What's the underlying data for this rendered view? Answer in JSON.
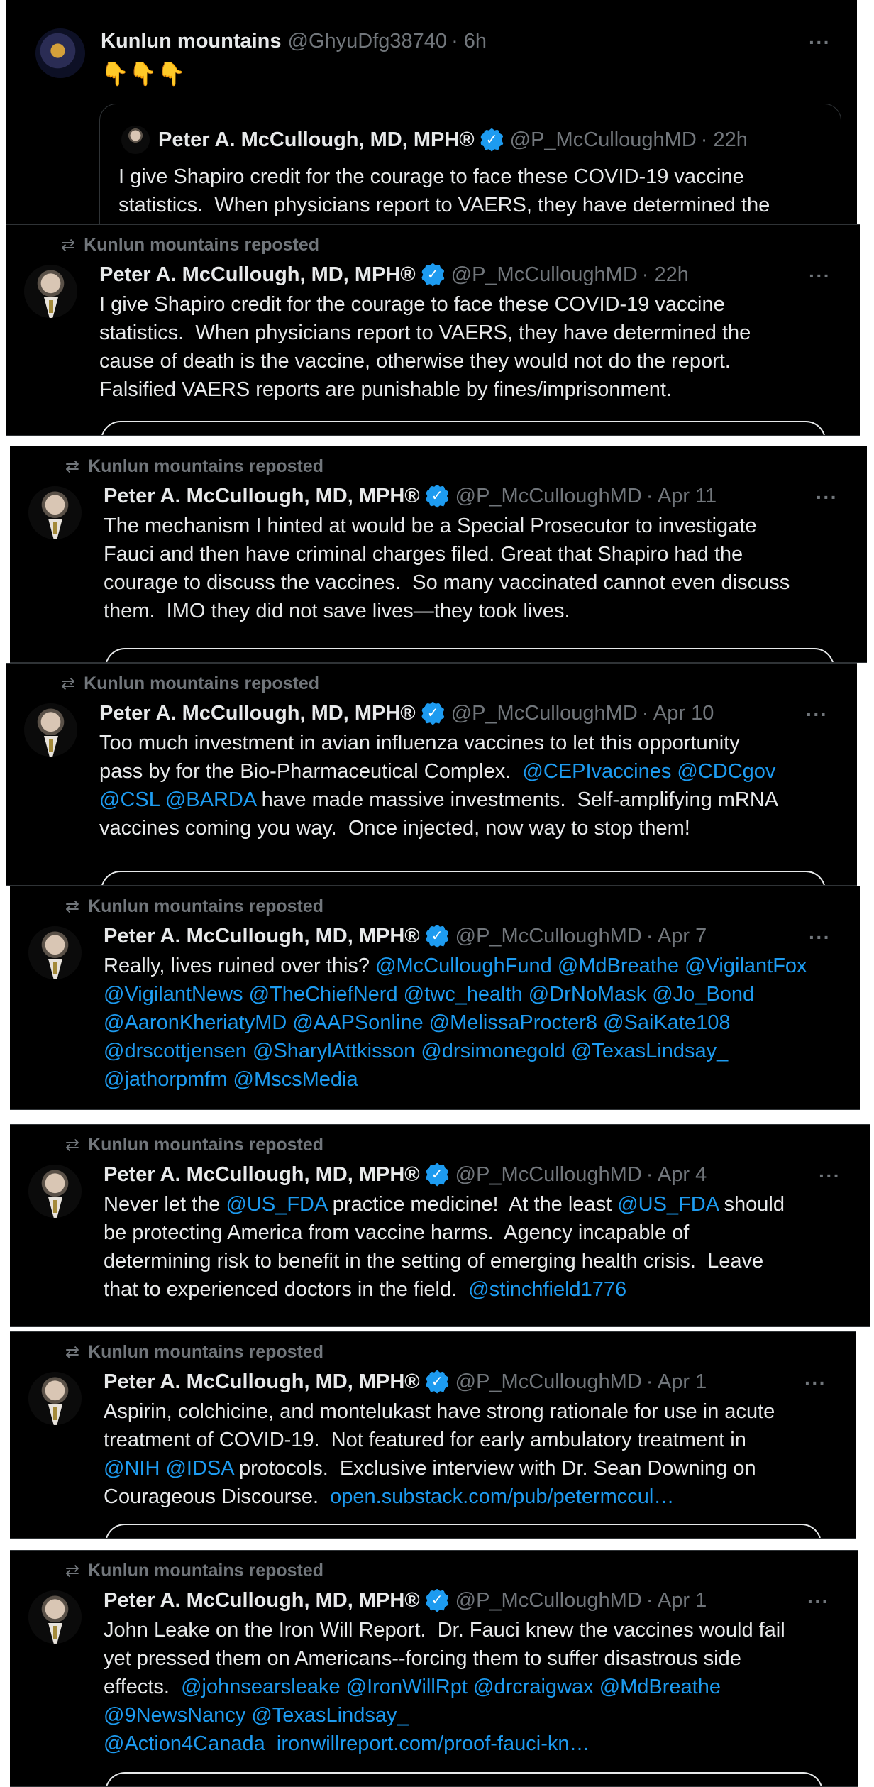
{
  "colors": {
    "background": "#000000",
    "text": "#e7e9ea",
    "secondary": "#71767b",
    "link": "#1d9bf0",
    "border": "#2f3336"
  },
  "icons": {
    "more": "more-horizontal-icon",
    "repost": "repost-icon",
    "verified": "verified-badge-icon"
  },
  "top_post": {
    "name": "Kunlun mountains",
    "handle": "@GhyuDfg38740",
    "time": "· 6h",
    "more": "···",
    "text": "👇👇👇",
    "quote": {
      "name": "Peter A. McCullough, MD, MPH®",
      "handle": "@P_McCulloughMD",
      "time": "· 22h",
      "text": "I give Shapiro credit for the courage to face these COVID-19 vaccine statistics.  When physicians report to VAERS, they have determined the"
    }
  },
  "reposts": [
    {
      "repost_label": "Kunlun mountains reposted",
      "name": "Peter A. McCullough, MD, MPH®",
      "handle": "@P_McCulloughMD",
      "time": "· 22h",
      "more": "···",
      "lines": [
        [
          {
            "t": "I give Shapiro credit for the courage to face these COVID-19 vaccine"
          }
        ],
        [
          {
            "t": "statistics.  When physicians report to VAERS, they have determined the"
          }
        ],
        [
          {
            "t": "cause of death is the vaccine, otherwise they would not do the report."
          }
        ],
        [
          {
            "t": "Falsified VAERS reports are punishable by fines/imprisonment."
          }
        ]
      ]
    },
    {
      "repost_label": "Kunlun mountains reposted",
      "name": "Peter A. McCullough, MD, MPH®",
      "handle": "@P_McCulloughMD",
      "time": "· Apr 11",
      "more": "···",
      "lines": [
        [
          {
            "t": "The mechanism I hinted at would be a Special Prosecutor to investigate"
          }
        ],
        [
          {
            "t": "Fauci and then have criminal charges filed. Great that Shapiro had the"
          }
        ],
        [
          {
            "t": "courage to discuss the vaccines.  So many vaccinated cannot even discuss"
          }
        ],
        [
          {
            "t": "them.  IMO they did not save lives—they took lives."
          }
        ]
      ]
    },
    {
      "repost_label": "Kunlun mountains reposted",
      "name": "Peter A. McCullough, MD, MPH®",
      "handle": "@P_McCulloughMD",
      "time": "· Apr 10",
      "more": "···",
      "lines": [
        [
          {
            "t": "Too much investment in avian influenza vaccines to let this opportunity"
          }
        ],
        [
          {
            "t": "pass by for the Bio-Pharmaceutical Complex.  "
          },
          {
            "t": "@CEPIvaccines",
            "m": true
          },
          {
            "t": " "
          },
          {
            "t": "@CDCgov",
            "m": true
          }
        ],
        [
          {
            "t": "@CSL",
            "m": true
          },
          {
            "t": " "
          },
          {
            "t": "@BARDA",
            "m": true
          },
          {
            "t": " have made massive investments.  Self-amplifying mRNA"
          }
        ],
        [
          {
            "t": "vaccines coming you way.  Once injected, now way to stop them!"
          }
        ]
      ]
    },
    {
      "repost_label": "Kunlun mountains reposted",
      "name": "Peter A. McCullough, MD, MPH®",
      "handle": "@P_McCulloughMD",
      "time": "· Apr 7",
      "more": "···",
      "lines": [
        [
          {
            "t": "Really, lives ruined over this? "
          },
          {
            "t": "@McCulloughFund",
            "m": true
          },
          {
            "t": " "
          },
          {
            "t": "@MdBreathe",
            "m": true
          },
          {
            "t": " "
          },
          {
            "t": "@VigilantFox",
            "m": true
          }
        ],
        [
          {
            "t": "@VigilantNews",
            "m": true
          },
          {
            "t": " "
          },
          {
            "t": "@TheChiefNerd",
            "m": true
          },
          {
            "t": " "
          },
          {
            "t": "@twc_health",
            "m": true
          },
          {
            "t": " "
          },
          {
            "t": "@DrNoMask",
            "m": true
          },
          {
            "t": " "
          },
          {
            "t": "@Jo_Bond",
            "m": true
          }
        ],
        [
          {
            "t": "@AaronKheriatyMD",
            "m": true
          },
          {
            "t": " "
          },
          {
            "t": "@AAPSonline",
            "m": true
          },
          {
            "t": " "
          },
          {
            "t": "@MelissaProcter8",
            "m": true
          },
          {
            "t": " "
          },
          {
            "t": "@SaiKate108",
            "m": true
          }
        ],
        [
          {
            "t": "@drscottjensen",
            "m": true
          },
          {
            "t": " "
          },
          {
            "t": "@SharylAttkisson",
            "m": true
          },
          {
            "t": " "
          },
          {
            "t": "@drsimonegold",
            "m": true
          },
          {
            "t": " "
          },
          {
            "t": "@TexasLindsay_",
            "m": true
          }
        ],
        [
          {
            "t": "@jathorpmfm",
            "m": true
          },
          {
            "t": " "
          },
          {
            "t": "@MscsMedia",
            "m": true
          }
        ]
      ]
    },
    {
      "repost_label": "Kunlun mountains reposted",
      "name": "Peter A. McCullough, MD, MPH®",
      "handle": "@P_McCulloughMD",
      "time": "· Apr 4",
      "more": "···",
      "lines": [
        [
          {
            "t": "Never let the "
          },
          {
            "t": "@US_FDA",
            "m": true
          },
          {
            "t": " practice medicine!  At the least "
          },
          {
            "t": "@US_FDA",
            "m": true
          },
          {
            "t": " should"
          }
        ],
        [
          {
            "t": "be protecting America from vaccine harms.  Agency incapable of"
          }
        ],
        [
          {
            "t": "determining risk to benefit in the setting of emerging health crisis.  Leave"
          }
        ],
        [
          {
            "t": "that to experienced doctors in the field.  "
          },
          {
            "t": "@stinchfield1776",
            "m": true
          }
        ]
      ]
    },
    {
      "repost_label": "Kunlun mountains reposted",
      "name": "Peter A. McCullough, MD, MPH®",
      "handle": "@P_McCulloughMD",
      "time": "· Apr 1",
      "more": "···",
      "lines": [
        [
          {
            "t": "Aspirin, colchicine, and montelukast have strong rationale for use in acute"
          }
        ],
        [
          {
            "t": "treatment of COVID-19.  Not featured for early ambulatory treatment in"
          }
        ],
        [
          {
            "t": "@NIH",
            "m": true
          },
          {
            "t": " "
          },
          {
            "t": "@IDSA",
            "m": true
          },
          {
            "t": " protocols.  Exclusive interview with Dr. Sean Downing on"
          }
        ],
        [
          {
            "t": "Courageous Discourse.  "
          },
          {
            "t": "open.substack.com/pub/petermccul…",
            "m": true
          }
        ]
      ]
    },
    {
      "repost_label": "Kunlun mountains reposted",
      "name": "Peter A. McCullough, MD, MPH®",
      "handle": "@P_McCulloughMD",
      "time": "· Apr 1",
      "more": "···",
      "lines": [
        [
          {
            "t": "John Leake on the Iron Will Report.  Dr. Fauci knew the vaccines would fail"
          }
        ],
        [
          {
            "t": "yet pressed them on Americans--forcing them to suffer disastrous side"
          }
        ],
        [
          {
            "t": "effects.  "
          },
          {
            "t": "@johnsearsleake",
            "m": true
          },
          {
            "t": " "
          },
          {
            "t": "@IronWillRpt",
            "m": true
          },
          {
            "t": " "
          },
          {
            "t": "@drcraigwax",
            "m": true
          },
          {
            "t": " "
          },
          {
            "t": "@MdBreathe",
            "m": true
          }
        ],
        [
          {
            "t": "@9NewsNancy",
            "m": true
          },
          {
            "t": " "
          },
          {
            "t": "@TexasLindsay_",
            "m": true
          }
        ],
        [
          {
            "t": "@Action4Canada",
            "m": true
          },
          {
            "t": "  "
          },
          {
            "t": "ironwillreport.com/proof-fauci-kn…",
            "m": true
          }
        ]
      ]
    }
  ]
}
